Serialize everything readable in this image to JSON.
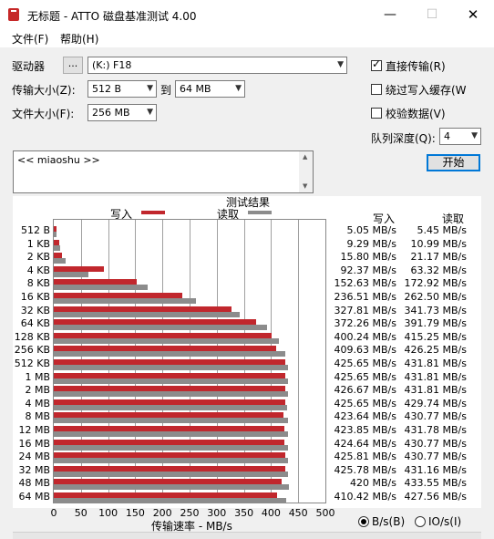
{
  "window": {
    "title": "无标题 - ATTO 磁盘基准测试 4.00",
    "minimize_glyph": "—",
    "maximize_glyph": "☐",
    "close_glyph": "✕"
  },
  "menu": {
    "file": "文件(F)",
    "help": "帮助(H)"
  },
  "form": {
    "drive_label": "驱动器",
    "browse_label": "...",
    "drive_value": "(K:) F18",
    "transfer_size_label": "传输大小(Z):",
    "transfer_from": "512 B",
    "to_label": "到",
    "transfer_to": "64 MB",
    "file_size_label": "文件大小(F):",
    "file_size": "256 MB",
    "direct_io_label": "直接传输(R)",
    "bypass_cache_label": "绕过写入缓存(W",
    "verify_label": "校验数据(V)",
    "queue_depth_label": "队列深度(Q):",
    "queue_depth": "4",
    "start_label": "开始",
    "notes": "<< miaoshu >>"
  },
  "results": {
    "title": "测试结果",
    "legend_write": "写入",
    "legend_read": "读取",
    "col_write": "写入",
    "col_read": "读取",
    "xlabel": "传输速率 - MB/s",
    "unit_bytes_label": "B/s(B)",
    "unit_io_label": "IO/s(I)"
  },
  "colors": {
    "write": "#c1272d",
    "read": "#8c8c8c"
  },
  "chart_data": {
    "type": "bar",
    "orientation": "horizontal",
    "title": "测试结果",
    "xlabel": "传输速率 - MB/s",
    "xlim": [
      0,
      500
    ],
    "xticks": [
      0,
      50,
      100,
      150,
      200,
      250,
      300,
      350,
      400,
      450,
      500
    ],
    "grid": true,
    "categories": [
      "512 B",
      "1 KB",
      "2 KB",
      "4 KB",
      "8 KB",
      "16 KB",
      "32 KB",
      "64 KB",
      "128 KB",
      "256 KB",
      "512 KB",
      "1 MB",
      "2 MB",
      "4 MB",
      "8 MB",
      "12 MB",
      "16 MB",
      "24 MB",
      "32 MB",
      "48 MB",
      "64 MB"
    ],
    "series": [
      {
        "name": "写入",
        "values": [
          5.05,
          9.29,
          15.8,
          92.37,
          152.63,
          236.51,
          327.81,
          372.26,
          400.24,
          409.63,
          425.65,
          425.65,
          426.67,
          425.65,
          423.64,
          423.85,
          424.64,
          425.81,
          425.78,
          420,
          410.42
        ]
      },
      {
        "name": "读取",
        "values": [
          5.45,
          10.99,
          21.17,
          63.32,
          172.92,
          262.5,
          341.73,
          391.79,
          415.25,
          426.25,
          431.81,
          431.81,
          431.81,
          429.74,
          430.77,
          431.78,
          430.77,
          430.77,
          431.16,
          433.55,
          427.56
        ]
      }
    ],
    "write_text": [
      "5.05 MB/s",
      "9.29 MB/s",
      "15.80 MB/s",
      "92.37 MB/s",
      "152.63 MB/s",
      "236.51 MB/s",
      "327.81 MB/s",
      "372.26 MB/s",
      "400.24 MB/s",
      "409.63 MB/s",
      "425.65 MB/s",
      "425.65 MB/s",
      "426.67 MB/s",
      "425.65 MB/s",
      "423.64 MB/s",
      "423.85 MB/s",
      "424.64 MB/s",
      "425.81 MB/s",
      "425.78 MB/s",
      "420 MB/s",
      "410.42 MB/s"
    ],
    "read_text": [
      "5.45 MB/s",
      "10.99 MB/s",
      "21.17 MB/s",
      "63.32 MB/s",
      "172.92 MB/s",
      "262.50 MB/s",
      "341.73 MB/s",
      "391.79 MB/s",
      "415.25 MB/s",
      "426.25 MB/s",
      "431.81 MB/s",
      "431.81 MB/s",
      "431.81 MB/s",
      "429.74 MB/s",
      "430.77 MB/s",
      "431.78 MB/s",
      "430.77 MB/s",
      "430.77 MB/s",
      "431.16 MB/s",
      "433.55 MB/s",
      "427.56 MB/s"
    ]
  }
}
